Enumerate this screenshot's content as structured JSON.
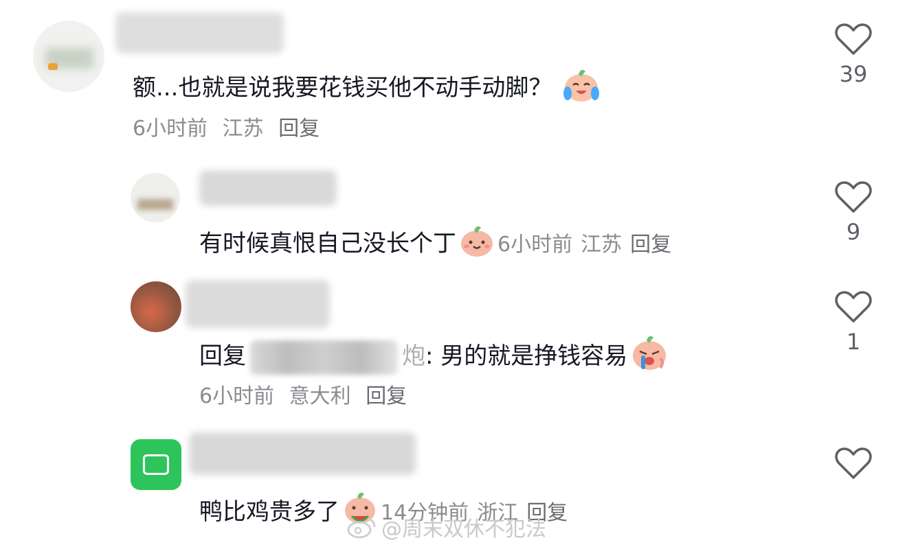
{
  "colors": {
    "text": "#161823",
    "meta": "#8a8b91",
    "like_icon": "#5f6066",
    "watermark": "#c9c9c9"
  },
  "comments": [
    {
      "text": "额...也就是说我要花钱买他不动手动脚？",
      "emoji": "laugh-cry-peach-emoji",
      "time": "6小时前",
      "location": "江苏",
      "reply": "回复",
      "likes": "39"
    },
    {
      "text": "有时候真恨自己没长个丁",
      "emoji": "smile-peach-emoji",
      "time": "6小时前",
      "location": "江苏",
      "reply": "回复",
      "likes": "9"
    },
    {
      "prefix": "回复",
      "mention_tail": "炮",
      "text": ": 男的就是挣钱容易",
      "emoji": "sob-peach-emoji",
      "time": "6小时前",
      "location": "意大利",
      "reply": "回复",
      "likes": "1"
    },
    {
      "text": "鸭比鸡贵多了",
      "emoji": "watermelon-peach-emoji",
      "time": "14分钟前",
      "location": "浙江",
      "reply": "回复",
      "likes": ""
    }
  ],
  "watermark": {
    "text": "@周末双休不犯法",
    "icon": "weibo-logo-icon"
  }
}
